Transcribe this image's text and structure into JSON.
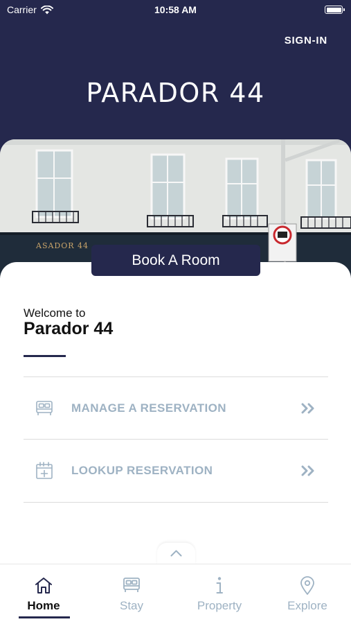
{
  "status_bar": {
    "carrier": "Carrier",
    "time": "10:58 AM"
  },
  "header": {
    "sign_in": "SIGN-IN",
    "logo": "PARADOR 44"
  },
  "hero": {
    "book_button": "Book A Room"
  },
  "welcome": {
    "subtitle": "Welcome to",
    "title": "Parador 44"
  },
  "menu": [
    {
      "label": "MANAGE A RESERVATION",
      "icon": "bed-icon"
    },
    {
      "label": "LOOKUP RESERVATION",
      "icon": "calendar-add-icon"
    }
  ],
  "tab_bar": {
    "tabs": [
      {
        "label": "Home",
        "icon": "home-icon",
        "active": true
      },
      {
        "label": "Stay",
        "icon": "bed-icon",
        "active": false
      },
      {
        "label": "Property",
        "icon": "info-icon",
        "active": false
      },
      {
        "label": "Explore",
        "icon": "map-pin-icon",
        "active": false
      }
    ]
  },
  "colors": {
    "navy": "#25284d",
    "muted_blue": "#9eb2c3",
    "white": "#ffffff"
  }
}
